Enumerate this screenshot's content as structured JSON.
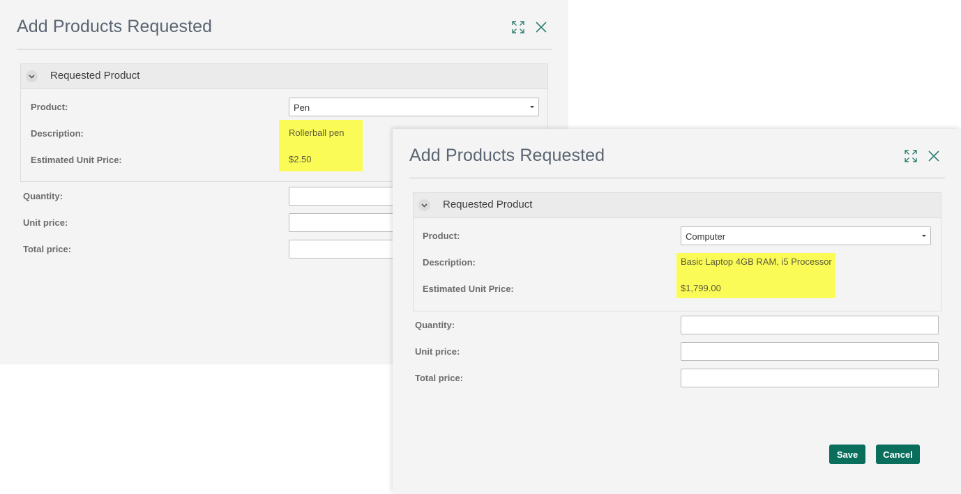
{
  "dialogs": [
    {
      "title": "Add Products Requested",
      "section_title": "Requested Product",
      "labels": {
        "product": "Product:",
        "description": "Description:",
        "estimated_unit_price": "Estimated Unit Price:",
        "quantity": "Quantity:",
        "unit_price": "Unit price:",
        "total_price": "Total price:"
      },
      "product_value": "Pen",
      "description_value": "Rollerball pen",
      "estimated_unit_price_value": "$2.50",
      "quantity_value": "",
      "unit_price_value": "",
      "total_price_value": ""
    },
    {
      "title": "Add Products Requested",
      "section_title": "Requested Product",
      "labels": {
        "product": "Product:",
        "description": "Description:",
        "estimated_unit_price": "Estimated Unit Price:",
        "quantity": "Quantity:",
        "unit_price": "Unit price:",
        "total_price": "Total price:"
      },
      "product_value": "Computer",
      "description_value": "Basic Laptop 4GB RAM, i5 Processor",
      "estimated_unit_price_value": "$1,799.00",
      "quantity_value": "",
      "unit_price_value": "",
      "total_price_value": "",
      "buttons": {
        "save": "Save",
        "cancel": "Cancel"
      }
    }
  ],
  "icons": {
    "expand": "expand-icon",
    "close": "close-icon",
    "collapse": "chevron-down-icon",
    "dropdown": "caret-down-icon"
  },
  "colors": {
    "accent": "#0a6e5c",
    "highlight": "#fbfb57",
    "dialog_bg": "#f4f4f4",
    "title_text": "#5a6572"
  }
}
